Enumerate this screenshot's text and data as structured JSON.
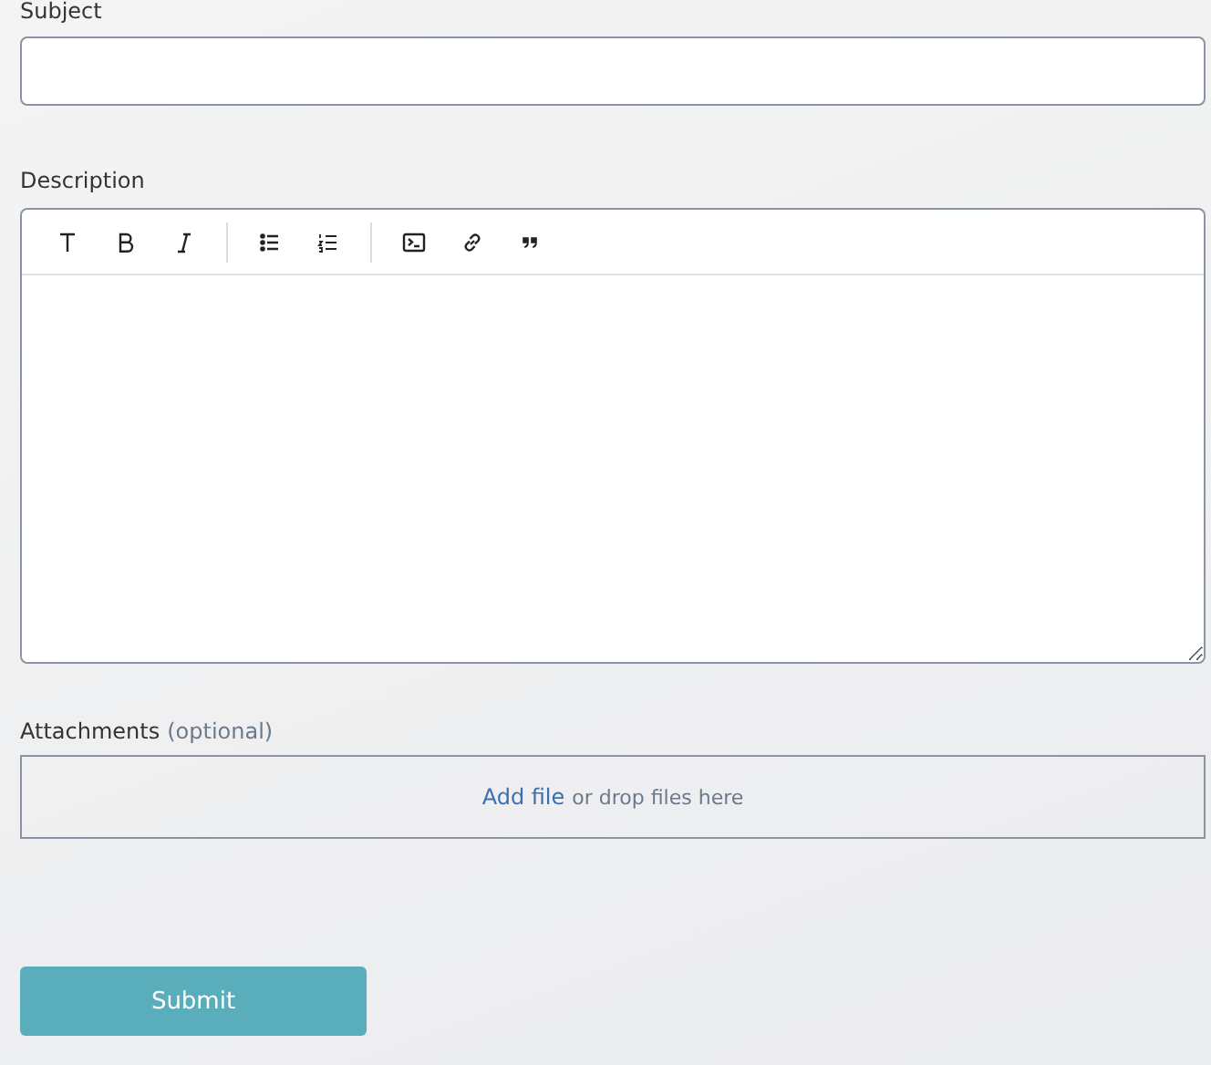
{
  "subject": {
    "label": "Subject"
  },
  "description": {
    "label": "Description"
  },
  "attachments": {
    "label": "Attachments",
    "hint": "(optional)",
    "link": "Add file",
    "text": "or drop files here"
  },
  "submit": "Submit"
}
